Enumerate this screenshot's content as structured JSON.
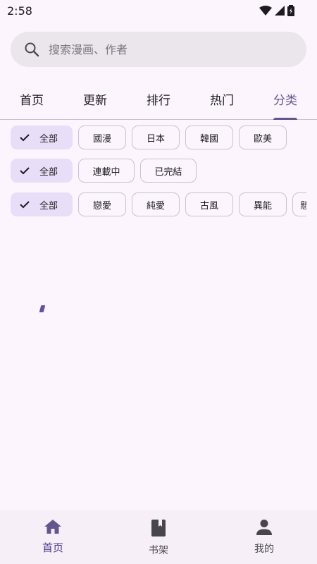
{
  "status": {
    "time": "2:58"
  },
  "search": {
    "placeholder": "搜索漫画、作者"
  },
  "tabs": [
    {
      "label": "首页",
      "active": false
    },
    {
      "label": "更新",
      "active": false
    },
    {
      "label": "排行",
      "active": false
    },
    {
      "label": "热门",
      "active": false
    },
    {
      "label": "分类",
      "active": true
    }
  ],
  "filters": {
    "region": [
      "全部",
      "國漫",
      "日本",
      "韓國",
      "歐美"
    ],
    "status": [
      "全部",
      "連載中",
      "已完結"
    ],
    "genre": [
      "全部",
      "戀愛",
      "純愛",
      "古風",
      "異能",
      "懸"
    ]
  },
  "bottom_nav": [
    {
      "label": "首页",
      "icon": "home-icon",
      "active": true
    },
    {
      "label": "书架",
      "icon": "bookshelf-icon",
      "active": false
    },
    {
      "label": "我的",
      "icon": "person-icon",
      "active": false
    }
  ],
  "colors": {
    "accent": "#65558f",
    "selected_chip": "#e8def8",
    "background": "#fcf5fd"
  }
}
